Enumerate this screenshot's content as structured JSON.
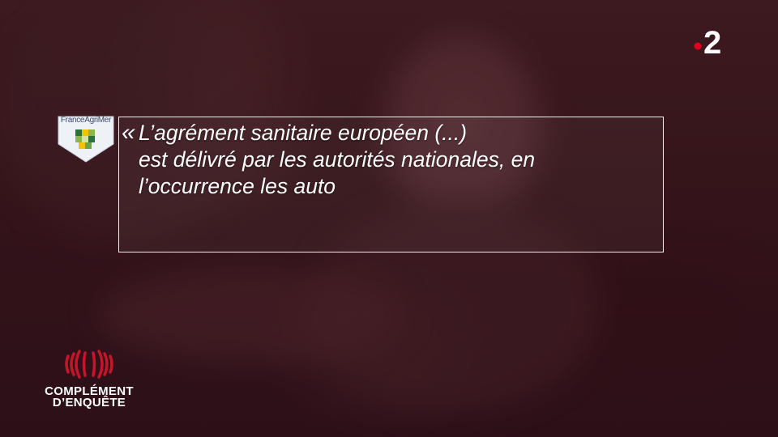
{
  "quote": {
    "open_mark": "«",
    "text": "L’agrément sanitaire européen (...)\nest délivré par les autorités nationales, en\nl’occurrence les auto"
  },
  "source_logo": {
    "label": "FranceAgriMer",
    "icon": "franceagrimer-logo"
  },
  "channel_logo": {
    "number": "2",
    "dot_color": "#e2001a",
    "icon": "france2-logo"
  },
  "program_logo": {
    "line1": "COMPLÉMENT",
    "line2": "D’ENQUÊTE",
    "icon": "complement-enquete-logo",
    "accent_color": "#c4162a"
  },
  "colors": {
    "tint": "#5a1620",
    "text": "#ffffff"
  }
}
